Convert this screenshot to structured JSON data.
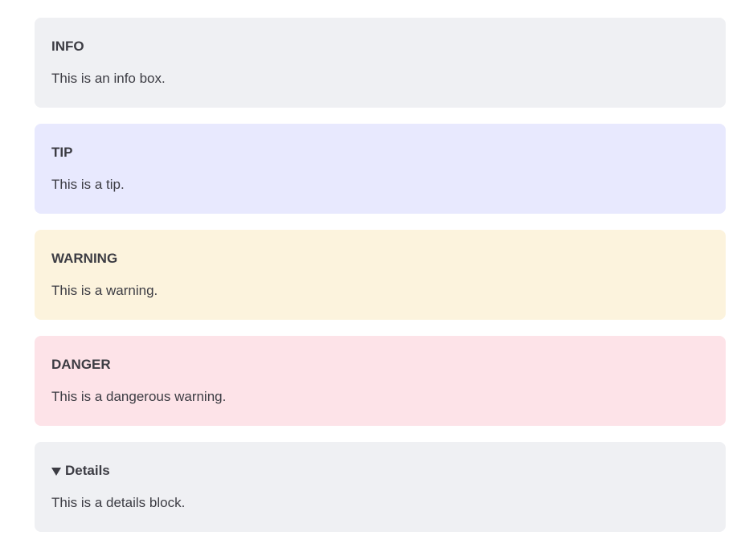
{
  "boxes": {
    "info": {
      "title": "INFO",
      "text": "This is an info box."
    },
    "tip": {
      "title": "TIP",
      "text": "This is a tip."
    },
    "warning": {
      "title": "WARNING",
      "text": "This is a warning."
    },
    "danger": {
      "title": "DANGER",
      "text": "This is a dangerous warning."
    },
    "details": {
      "title": "Details",
      "text": "This is a details block.",
      "icon": "caret-down-icon"
    }
  },
  "colors": {
    "info_bg": "#eff0f3",
    "tip_bg": "#e8e9fe",
    "warning_bg": "#fcf3dd",
    "danger_bg": "#fde3e8",
    "details_bg": "#eff0f3",
    "text": "#3c3c43"
  }
}
